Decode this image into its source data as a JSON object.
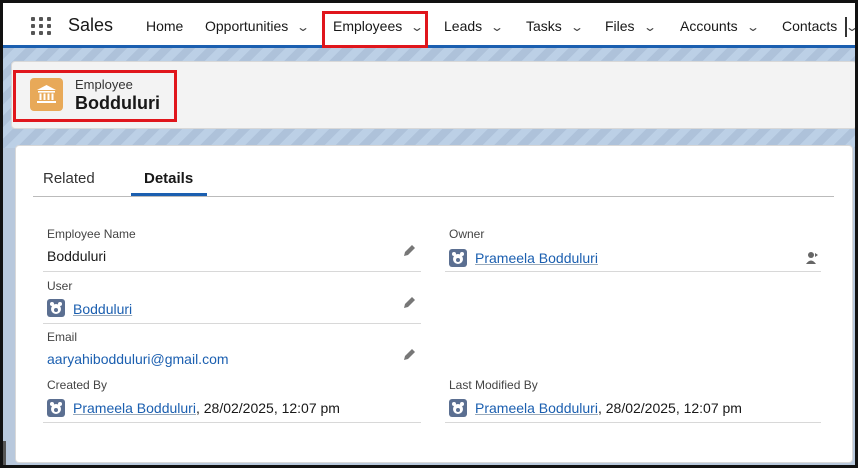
{
  "nav": {
    "app_name": "Sales",
    "items": [
      {
        "label": "Home",
        "chevron": false
      },
      {
        "label": "Opportunities",
        "chevron": true
      },
      {
        "label": "Employees",
        "chevron": true,
        "active": true
      },
      {
        "label": "Leads",
        "chevron": true
      },
      {
        "label": "Tasks",
        "chevron": true
      },
      {
        "label": "Files",
        "chevron": true
      },
      {
        "label": "Accounts",
        "chevron": true
      },
      {
        "label": "Contacts",
        "chevron": true
      }
    ]
  },
  "header": {
    "object_type": "Employee",
    "record_name": "Bodduluri",
    "icon": "building-icon",
    "icon_color": "#e8a958"
  },
  "tabs": {
    "related": "Related",
    "details": "Details"
  },
  "fields": {
    "employee_name": {
      "label": "Employee Name",
      "value": "Bodduluri"
    },
    "owner": {
      "label": "Owner",
      "value": "Prameela Bodduluri"
    },
    "user": {
      "label": "User",
      "value": "Bodduluri"
    },
    "email": {
      "label": "Email",
      "value": "aaryahibodduluri@gmail.com"
    },
    "created_by": {
      "label": "Created By",
      "user": "Prameela Bodduluri",
      "date": ", 28/02/2025, 12:07 pm"
    },
    "last_modified_by": {
      "label": "Last Modified By",
      "user": "Prameela Bodduluri",
      "date": ", 28/02/2025, 12:07 pm"
    }
  },
  "colors": {
    "accent": "#1b5fb0",
    "highlight": "#e0161c",
    "avatar": "#5b6f91"
  }
}
